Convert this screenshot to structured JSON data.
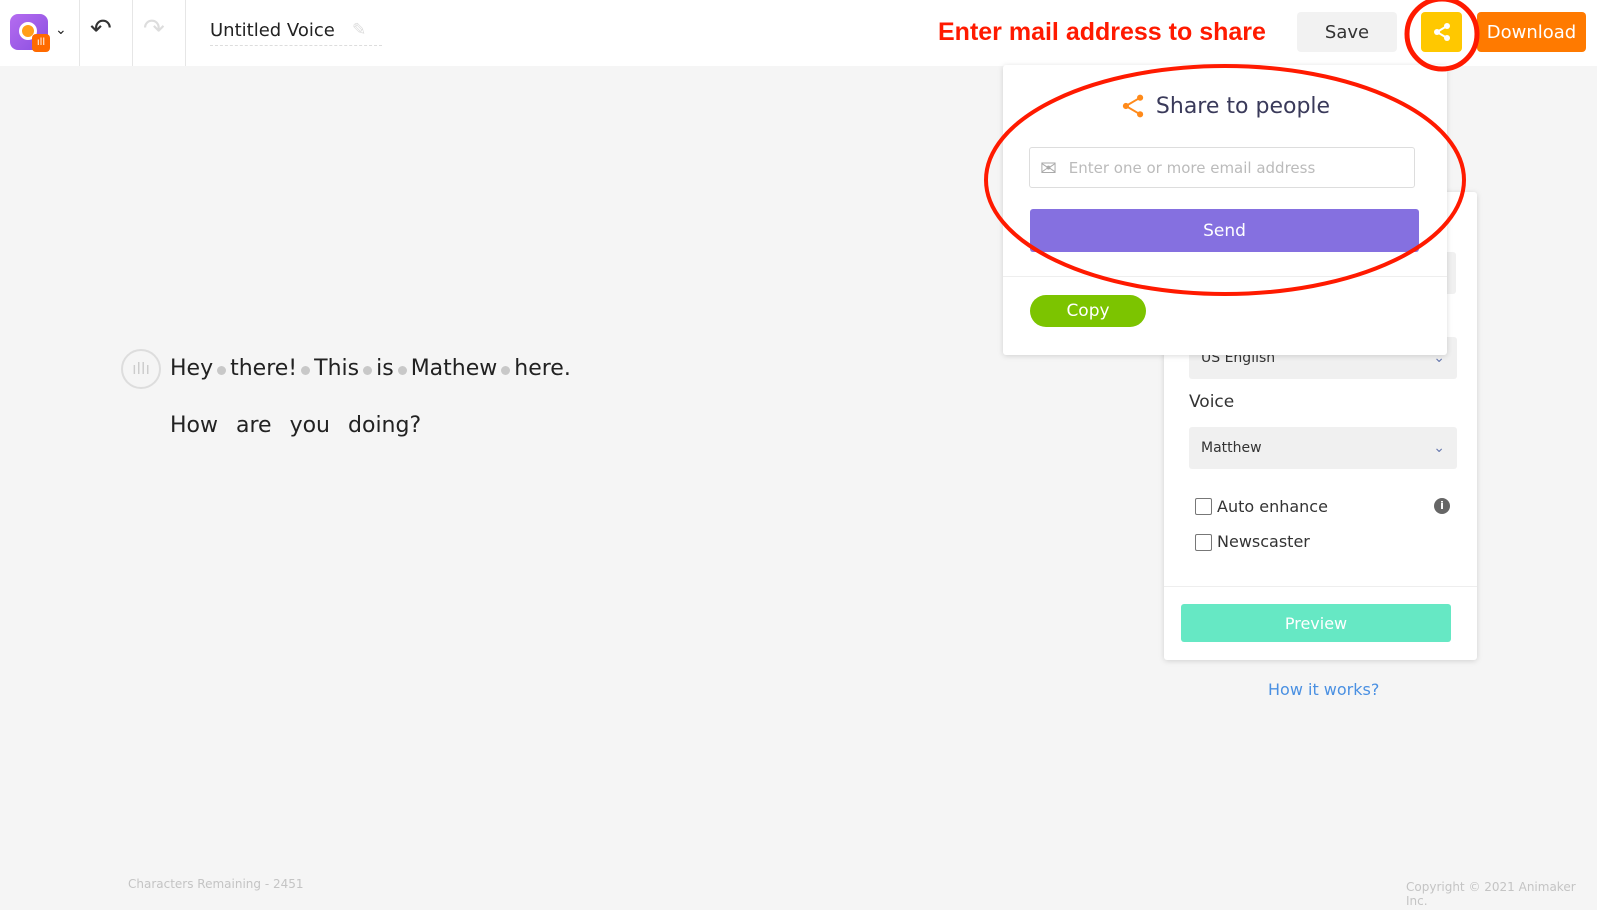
{
  "header": {
    "title": "Untitled Voice",
    "save_label": "Save",
    "download_label": "Download"
  },
  "annotation": {
    "text": "Enter mail address to share",
    "color": "#ff1a00"
  },
  "share_popup": {
    "title": "Share to people",
    "email_placeholder": "Enter one or more email address",
    "send_label": "Send",
    "copy_label": "Copy"
  },
  "settings": {
    "language": "US English",
    "voice_label": "Voice",
    "voice": "Matthew",
    "auto_enhance_label": "Auto enhance",
    "auto_enhance": false,
    "newscaster_label": "Newscaster",
    "newscaster": false,
    "preview_label": "Preview",
    "help_link": "How it works?"
  },
  "script": {
    "line1": [
      "Hey",
      "there!",
      "This",
      "is",
      "Mathew",
      "here."
    ],
    "line2": [
      "How",
      "are",
      "you",
      "doing?"
    ]
  },
  "footer": {
    "chars_remaining": "Characters Remaining - 2451",
    "copyright": "Copyright © 2021 Animaker Inc."
  },
  "colors": {
    "share": "#ffc800",
    "download": "#ff7a00",
    "send": "#8570e0",
    "copy": "#7cc400",
    "preview": "#66e8c4",
    "link": "#4a90e2"
  }
}
